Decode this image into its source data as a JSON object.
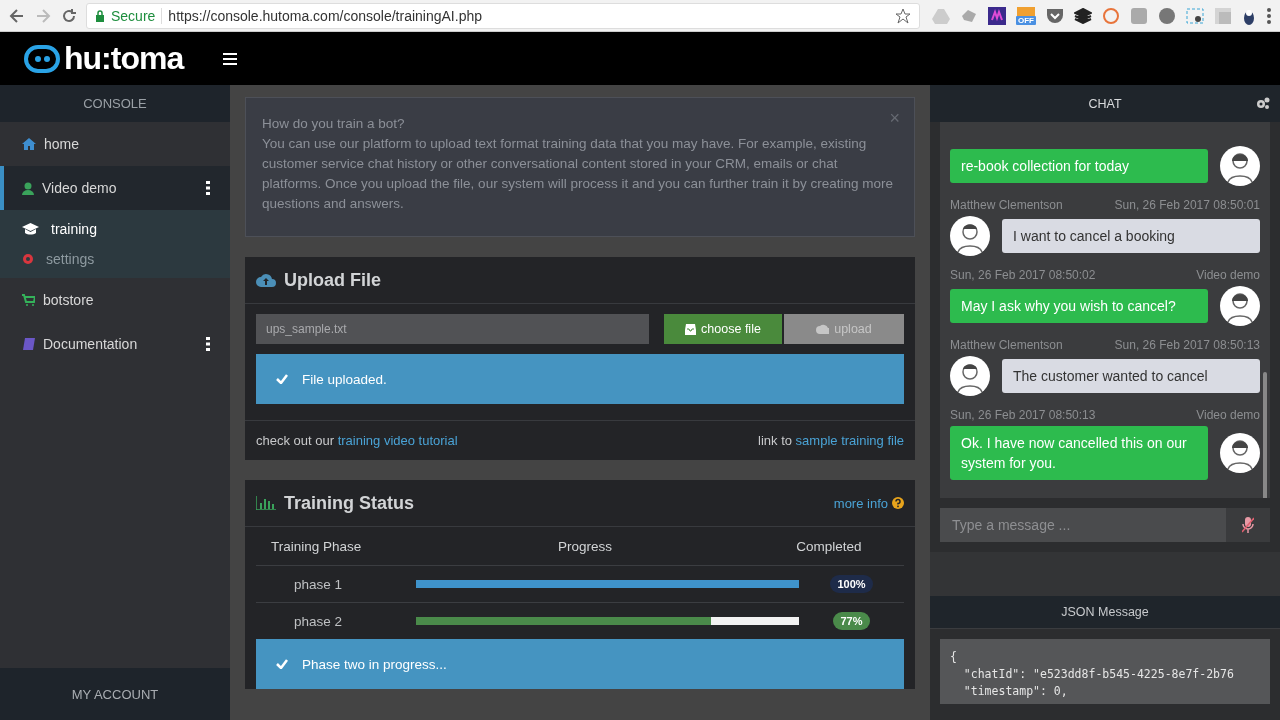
{
  "browser": {
    "secure_label": "Secure",
    "url": "https://console.hutoma.com/console/trainingAI.php",
    "extension_badge": "OFF"
  },
  "header": {
    "logo": "hu:toma"
  },
  "sidebar": {
    "heading": "CONSOLE",
    "items": [
      {
        "kind": "home",
        "label": "home",
        "selected": false,
        "has_menu": false
      },
      {
        "kind": "bot",
        "label": "Video demo",
        "selected": true,
        "has_menu": true,
        "children": [
          {
            "kind": "training",
            "label": "training",
            "selected": true
          },
          {
            "kind": "settings",
            "label": "settings",
            "selected": false
          }
        ]
      },
      {
        "kind": "store",
        "label": "botstore",
        "selected": false,
        "has_menu": false
      },
      {
        "kind": "docs",
        "label": "Documentation",
        "selected": false,
        "has_menu": true
      }
    ],
    "footer": "MY ACCOUNT"
  },
  "info": {
    "title": "How do you train a bot?",
    "text": "You can use our platform to upload text format training data that you may have. For example, existing customer service chat history or other conversational content stored in your CRM, emails or chat platforms. Once you upload the file, our system will process it and you can further train it by creating more questions and answers.",
    "close": "×"
  },
  "upload": {
    "title": "Upload File",
    "file_value": "ups_sample.txt",
    "choose_label": "choose file",
    "upload_label": "upload",
    "upload_disabled": true,
    "alert": "File uploaded.",
    "tutorial_prefix": "check out our",
    "tutorial_link": "training video tutorial",
    "sample_prefix": "link to",
    "sample_link": "sample training file"
  },
  "training": {
    "title": "Training Status",
    "more_info": "more info",
    "columns": [
      "Training Phase",
      "Progress",
      "Completed"
    ],
    "phases": [
      {
        "name": "phase 1",
        "level": 1,
        "reading": "100%",
        "kind": "complete",
        "color": "#3f93cb"
      },
      {
        "name": "phase 2",
        "level": 0.77,
        "reading": "77%",
        "kind": "running",
        "color": "#4a8a4a"
      }
    ],
    "alert": "Phase two in progress..."
  },
  "chat": {
    "title": "CHAT",
    "messages": [
      {
        "kind": "bot",
        "text": "re-book collection for today"
      },
      {
        "kind": "user",
        "author": "Matthew Clementson",
        "time": "Sun, 26 Feb 2017 08:50:01",
        "text": "I want to cancel a booking"
      },
      {
        "kind": "bot",
        "author": "Video demo",
        "time": "Sun, 26 Feb 2017 08:50:02",
        "text": "May I ask why you wish to cancel?"
      },
      {
        "kind": "user",
        "author": "Matthew Clementson",
        "time": "Sun, 26 Feb 2017 08:50:13",
        "text": "The customer wanted to cancel"
      },
      {
        "kind": "bot",
        "author": "Video demo",
        "time": "Sun, 26 Feb 2017 08:50:13",
        "text": "Ok. I have now cancelled this on our system for you."
      }
    ],
    "placeholder": "Type a message ..."
  },
  "json_panel": {
    "title": "JSON Message",
    "lines": [
      "{",
      "  \"chatId\": \"e523dd8f-b545-4225-8e7f-2b76",
      "  \"timestamp\": 0,"
    ]
  }
}
